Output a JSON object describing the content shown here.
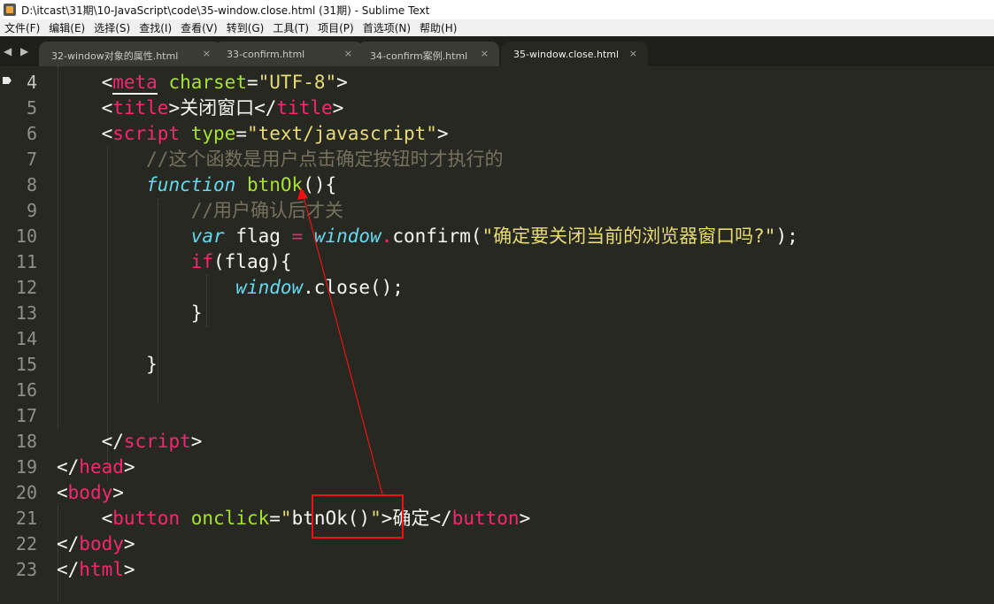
{
  "window": {
    "title": "D:\\itcast\\31期\\10-JavaScript\\code\\35-window.close.html (31期) - Sublime Text"
  },
  "menu": [
    "文件(F)",
    "编辑(E)",
    "选择(S)",
    "查找(I)",
    "查看(V)",
    "转到(G)",
    "工具(T)",
    "项目(P)",
    "首选项(N)",
    "帮助(H)"
  ],
  "tabs": [
    {
      "label": "32-window对象的属性.html",
      "active": false
    },
    {
      "label": "33-confirm.html",
      "active": false
    },
    {
      "label": "34-confirm案例.html",
      "active": false
    },
    {
      "label": "35-window.close.html",
      "active": true
    }
  ],
  "tab_close_glyph": "×",
  "tab_nav_glyph": "◀ ▶",
  "line_numbers": [
    "4",
    "5",
    "6",
    "7",
    "8",
    "9",
    "10",
    "11",
    "12",
    "13",
    "14",
    "15",
    "16",
    "17",
    "18",
    "19",
    "20",
    "21",
    "22",
    "23"
  ],
  "code": {
    "l4": {
      "lt": "<",
      "tag": "meta",
      "sp": " ",
      "attr": "charset",
      "eq": "=",
      "val": "\"UTF-8\"",
      "gt": ">"
    },
    "l5": {
      "lt": "<",
      "tag": "title",
      "gt": ">",
      "text": "关闭窗口",
      "lt2": "</",
      "tag2": "title",
      "gt2": ">"
    },
    "l6": {
      "lt": "<",
      "tag": "script",
      "sp": " ",
      "attr": "type",
      "eq": "=",
      "val": "\"text/javascript\"",
      "gt": ">"
    },
    "l7": {
      "comment": "//这个函数是用户点击确定按钮时才执行的"
    },
    "l8": {
      "kw": "function",
      "sp": " ",
      "fn": "btnOk",
      "rest": "(){"
    },
    "l9": {
      "comment": "//用户确认后才关"
    },
    "l10": {
      "kw": "var",
      "sp": " ",
      "var": "flag ",
      "op": "=",
      "sp2": " ",
      "obj": "window",
      "dot": ".",
      "method": "confirm(",
      "str": "\"确定要关闭当前的浏览器窗口吗?\"",
      "end": ");"
    },
    "l11": {
      "kw": "if",
      "rest": "(flag){"
    },
    "l12": {
      "obj": "window",
      "rest": ".close();"
    },
    "l13": {
      "text": "}"
    },
    "l15": {
      "text": "}"
    },
    "l18": {
      "lt": "</",
      "tag": "script",
      "gt": ">"
    },
    "l19": {
      "lt": "</",
      "tag": "head",
      "gt": ">"
    },
    "l20": {
      "lt": "<",
      "tag": "body",
      "gt": ">"
    },
    "l21": {
      "lt": "<",
      "tag": "button",
      "sp": " ",
      "attr": "onclick",
      "eq": "=",
      "q1": "\"",
      "val": "btnOk()",
      "q2": "\"",
      "gt": ">",
      "text": "确定",
      "lt2": "</",
      "tag2": "button",
      "gt2": ">"
    },
    "l22": {
      "lt": "</",
      "tag": "body",
      "gt": ">"
    },
    "l23": {
      "lt": "</",
      "tag": "html",
      "gt": ">"
    }
  },
  "colors": {
    "background": "#272822",
    "tag": "#f92672",
    "attribute": "#a6e22e",
    "string": "#e6db74",
    "comment": "#75715e",
    "keyword": "#66d9ef",
    "annotation": "#ee1111"
  }
}
